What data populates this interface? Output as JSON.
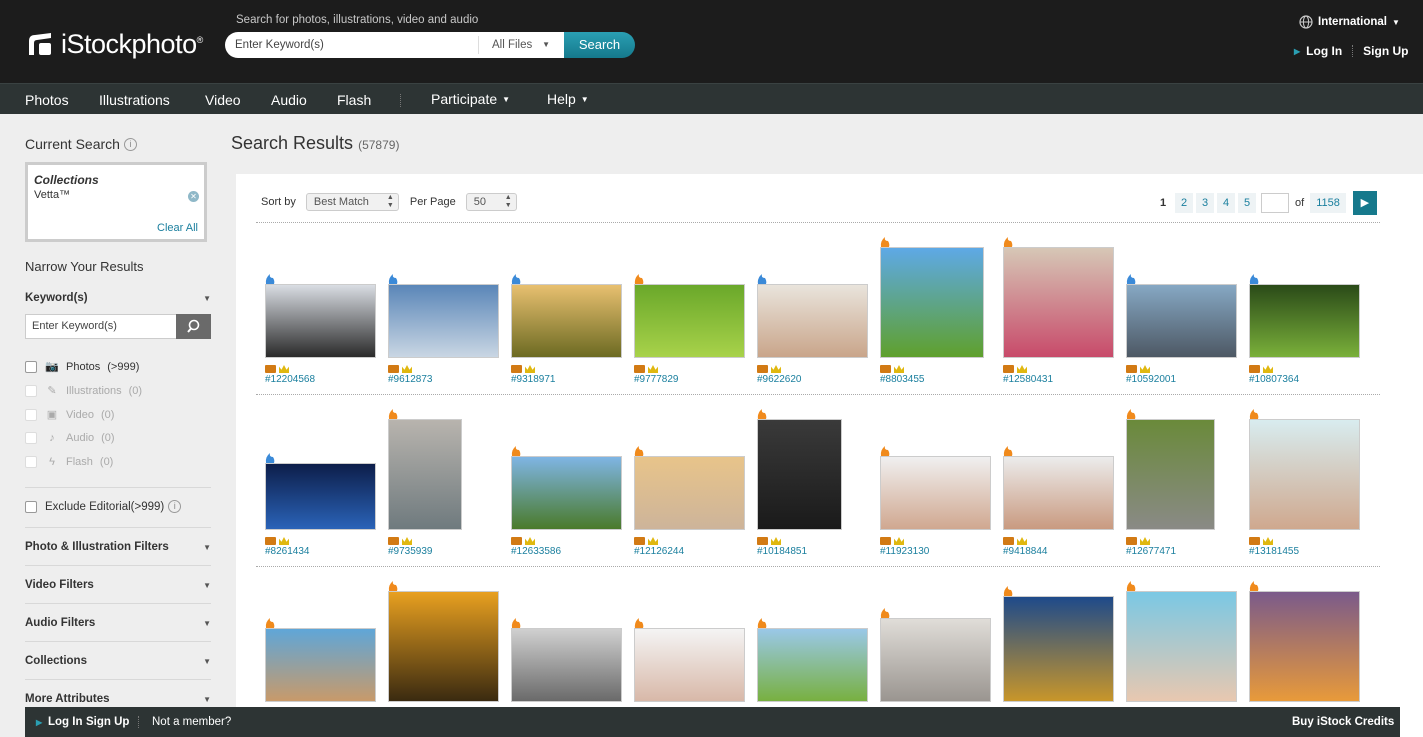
{
  "header": {
    "logo": "iStockphoto",
    "logo_mark": "®",
    "search_caption": "Search for photos, illustrations, video and audio",
    "search_placeholder": "Enter Keyword(s)",
    "file_filter": "All Files",
    "search_button": "Search",
    "region": "International",
    "login": "Log In",
    "signup": "Sign Up"
  },
  "nav": {
    "items": [
      "Photos",
      "Illustrations",
      "Video",
      "Audio",
      "Flash"
    ],
    "participate": "Participate",
    "help": "Help"
  },
  "sidebar": {
    "current_search": "Current Search",
    "collections_label": "Collections",
    "collections_value": "Vetta™",
    "clear_all": "Clear All",
    "narrow": "Narrow Your Results",
    "keywords_heading": "Keyword(s)",
    "keyword_placeholder": "Enter Keyword(s)",
    "file_types": [
      {
        "label": "Photos",
        "count": "(>999)"
      },
      {
        "label": "Illustrations",
        "count": "(0)"
      },
      {
        "label": "Video",
        "count": "(0)"
      },
      {
        "label": "Audio",
        "count": "(0)"
      },
      {
        "label": "Flash",
        "count": "(0)"
      }
    ],
    "exclude_editorial": "Exclude Editorial(>999)",
    "filters": [
      "Photo & Illustration Filters",
      "Video Filters",
      "Audio Filters",
      "Collections",
      "More Attributes"
    ]
  },
  "results": {
    "title": "Search Results",
    "count": "(57879)",
    "sort_label": "Sort by",
    "sort_value": "Best Match",
    "per_page_label": "Per Page",
    "per_page_value": "50",
    "pages": [
      "1",
      "2",
      "3",
      "4",
      "5"
    ],
    "of_label": "of",
    "total_pages": "1158",
    "rows": [
      [
        {
          "id": "#12204568",
          "badge": "blue",
          "top": "#d9dde3",
          "bottom": "#2a2a2a"
        },
        {
          "id": "#9612873",
          "badge": "blue",
          "top": "#5a86b8",
          "bottom": "#c9d6e3"
        },
        {
          "id": "#9318971",
          "badge": "blue",
          "top": "#e8c070",
          "bottom": "#6c6a22"
        },
        {
          "id": "#9777829",
          "badge": "orange",
          "top": "#6aa82a",
          "bottom": "#a8d24a"
        },
        {
          "id": "#9622620",
          "badge": "blue",
          "top": "#e9e4dc",
          "bottom": "#c9a58a"
        },
        {
          "id": "#8803455",
          "badge": "orange",
          "top": "#5ea9e6",
          "bottom": "#5fa02c"
        },
        {
          "id": "#12580431",
          "badge": "orange",
          "top": "#d6c7b6",
          "bottom": "#c84a6a"
        },
        {
          "id": "#10592001",
          "badge": "blue",
          "top": "#86a8c4",
          "bottom": "#4d5864"
        },
        {
          "id": "#10807364",
          "badge": "blue",
          "top": "#2a4a18",
          "bottom": "#7ab03a"
        }
      ],
      [
        {
          "id": "#8261434",
          "badge": "blue",
          "top": "#0d1e4a",
          "bottom": "#2a63b8"
        },
        {
          "id": "#9735939",
          "badge": "orange",
          "top": "#b8b4ae",
          "bottom": "#6f7a7e"
        },
        {
          "id": "#12633586",
          "badge": "orange",
          "top": "#7fb5e4",
          "bottom": "#4a7a2a"
        },
        {
          "id": "#12126244",
          "badge": "orange",
          "top": "#e8c48a",
          "bottom": "#cdb49a"
        },
        {
          "id": "#10184851",
          "badge": "orange",
          "top": "#3a3a3a",
          "bottom": "#1a1a1a"
        },
        {
          "id": "#11923130",
          "badge": "orange",
          "top": "#f0f0f0",
          "bottom": "#d0a890"
        },
        {
          "id": "#9418844",
          "badge": "orange",
          "top": "#ececec",
          "bottom": "#c99a80"
        },
        {
          "id": "#12677471",
          "badge": "orange",
          "top": "#6a8a3a",
          "bottom": "#8a8a86"
        },
        {
          "id": "#13181455",
          "badge": "orange",
          "top": "#d8ecef",
          "bottom": "#cfa88e"
        }
      ],
      [
        {
          "id": "",
          "badge": "orange",
          "top": "#5fa6d8",
          "bottom": "#c89a6a"
        },
        {
          "id": "",
          "badge": "orange",
          "top": "#e8a020",
          "bottom": "#3a2a10"
        },
        {
          "id": "",
          "badge": "orange",
          "top": "#d0d0d0",
          "bottom": "#6a6a6a"
        },
        {
          "id": "",
          "badge": "orange",
          "top": "#f4f4f4",
          "bottom": "#d8b8a8"
        },
        {
          "id": "",
          "badge": "orange",
          "top": "#9ac8e8",
          "bottom": "#78b040"
        },
        {
          "id": "",
          "badge": "orange",
          "top": "#e0ddd8",
          "bottom": "#9a9590"
        },
        {
          "id": "",
          "badge": "orange",
          "top": "#1e4a8a",
          "bottom": "#c8962a"
        },
        {
          "id": "",
          "badge": "orange",
          "top": "#7ac8e4",
          "bottom": "#e8c8b0"
        },
        {
          "id": "",
          "badge": "orange",
          "top": "#7a5a8a",
          "bottom": "#e89a3a"
        }
      ]
    ]
  },
  "footer": {
    "login": "Log In",
    "signup": "Sign Up",
    "not_member": "Not a member?",
    "buy": "Buy iStock Credits"
  },
  "colors": {
    "accent": "#16798c",
    "link": "#1a7f9e",
    "header_bg": "#1c1c1c",
    "nav_bg": "#2d3434",
    "badge_blue": "#3b8ad8",
    "badge_orange": "#f08a1c"
  }
}
